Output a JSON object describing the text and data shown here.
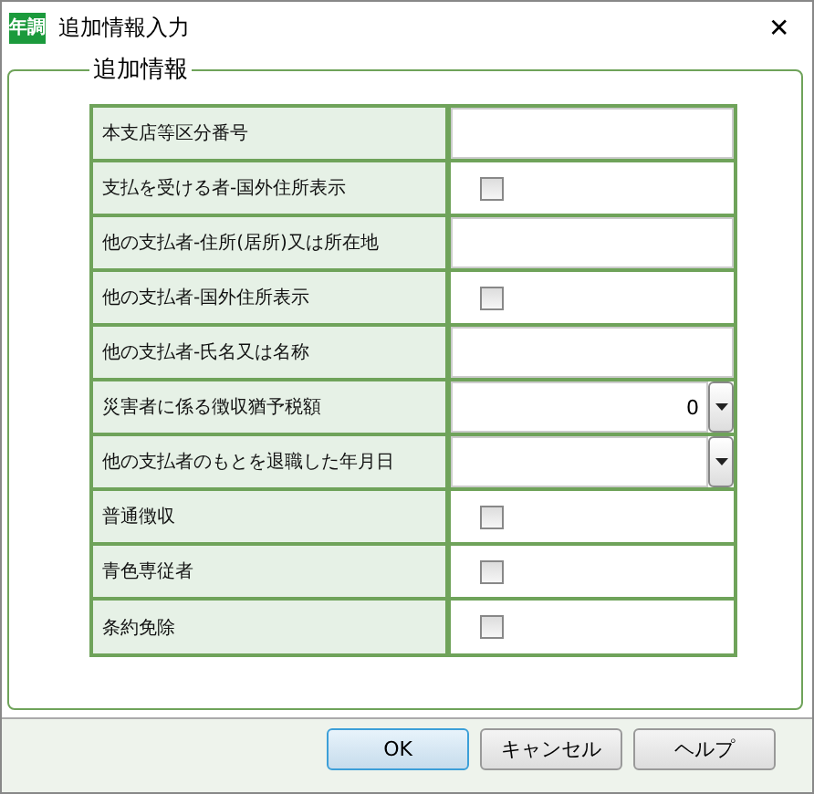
{
  "window": {
    "icon_text": "年調",
    "title": "追加情報入力",
    "close": "✕"
  },
  "group": {
    "legend": "追加情報"
  },
  "rows": [
    {
      "label": "本支店等区分番号",
      "kind": "text"
    },
    {
      "label": "支払を受ける者-国外住所表示",
      "kind": "checkbox",
      "checked": false
    },
    {
      "label": "他の支払者-住所(居所)又は所在地",
      "kind": "text"
    },
    {
      "label": "他の支払者-国外住所表示",
      "kind": "checkbox",
      "checked": false
    },
    {
      "label": "他の支払者-氏名又は名称",
      "kind": "text"
    },
    {
      "label": "災害者に係る徴収猶予税額",
      "kind": "dropdown",
      "value": "0"
    },
    {
      "label": "他の支払者のもとを退職した年月日",
      "kind": "dropdown"
    },
    {
      "label": "普通徴収",
      "kind": "checkbox",
      "checked": false
    },
    {
      "label": "青色専従者",
      "kind": "checkbox",
      "checked": false
    },
    {
      "label": "条約免除",
      "kind": "checkbox",
      "checked": false
    }
  ],
  "buttons": [
    {
      "label": "OK",
      "default": true
    },
    {
      "label": "キャンセル",
      "default": false
    },
    {
      "label": "ヘルプ",
      "default": false
    }
  ]
}
